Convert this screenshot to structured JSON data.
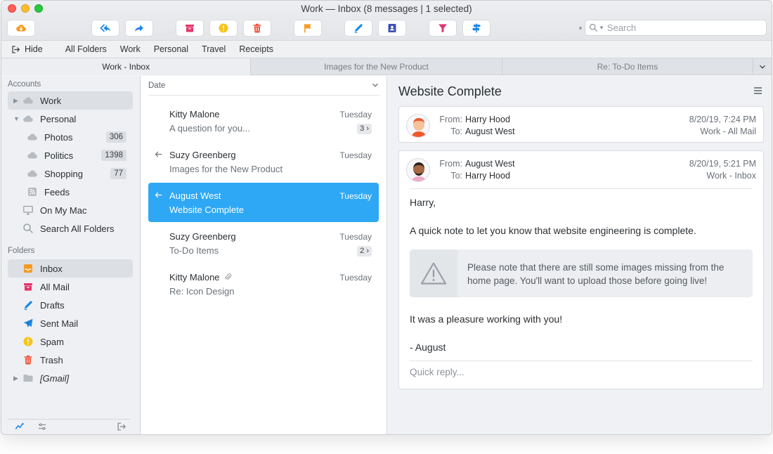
{
  "window": {
    "title": "Work — Inbox (8 messages | 1 selected)"
  },
  "toolbar": {
    "buttons": [
      {
        "id": "get-mail",
        "icon": "cloud-download-icon",
        "color": "#f59a23"
      },
      {
        "id": "reply-all",
        "icon": "reply-all-icon",
        "color": "#1e88e5"
      },
      {
        "id": "forward",
        "icon": "forward-icon",
        "color": "#1e88e5"
      },
      {
        "id": "archive",
        "icon": "archive-icon",
        "color": "#e6336b"
      },
      {
        "id": "spam",
        "icon": "spam-icon",
        "color": "#f5c518"
      },
      {
        "id": "trash",
        "icon": "trash-icon",
        "color": "#f0553c"
      },
      {
        "id": "flag",
        "icon": "flag-icon",
        "color": "#f59a23"
      },
      {
        "id": "compose",
        "icon": "compose-icon",
        "color": "#1e88e5"
      },
      {
        "id": "contacts",
        "icon": "contacts-icon",
        "color": "#3f51b5"
      },
      {
        "id": "filter",
        "icon": "filter-icon",
        "color": "#e6336b"
      },
      {
        "id": "rules",
        "icon": "signpost-icon",
        "color": "#1e88e5"
      }
    ],
    "search_placeholder": "Search"
  },
  "favorites": {
    "hide_label": "Hide",
    "items": [
      "All Folders",
      "Work",
      "Personal",
      "Travel",
      "Receipts"
    ]
  },
  "tabs": [
    {
      "label": "Work - Inbox",
      "active": true
    },
    {
      "label": "Images for the New Product",
      "active": false
    },
    {
      "label": "Re: To-Do Items",
      "active": false
    }
  ],
  "sidebar": {
    "accounts_label": "Accounts",
    "folders_label": "Folders",
    "accounts": [
      {
        "label": "Work",
        "count": ""
      },
      {
        "label": "Personal",
        "count": ""
      },
      {
        "label": "Photos",
        "count": "306"
      },
      {
        "label": "Politics",
        "count": "1398"
      },
      {
        "label": "Shopping",
        "count": "77"
      },
      {
        "label": "Feeds",
        "count": ""
      },
      {
        "label": "On My Mac",
        "count": ""
      },
      {
        "label": "Search All Folders",
        "count": ""
      }
    ],
    "folders": [
      {
        "label": "Inbox"
      },
      {
        "label": "All Mail"
      },
      {
        "label": "Drafts"
      },
      {
        "label": "Sent Mail"
      },
      {
        "label": "Spam"
      },
      {
        "label": "Trash"
      },
      {
        "label": "[Gmail]"
      }
    ]
  },
  "message_list": {
    "sort_label": "Date",
    "messages": [
      {
        "sender": "Kitty Malone",
        "subject": "A question for you...",
        "date": "Tuesday",
        "thread_count": "3",
        "replied": false,
        "attachment": false,
        "selected": false
      },
      {
        "sender": "Suzy Greenberg",
        "subject": "Images for the New Product",
        "date": "Tuesday",
        "thread_count": "",
        "replied": true,
        "attachment": false,
        "selected": false
      },
      {
        "sender": "August West",
        "subject": "Website Complete",
        "date": "Tuesday",
        "thread_count": "",
        "replied": true,
        "attachment": false,
        "selected": true
      },
      {
        "sender": "Suzy Greenberg",
        "subject": "To-Do Items",
        "date": "Tuesday",
        "thread_count": "2",
        "replied": false,
        "attachment": false,
        "selected": false
      },
      {
        "sender": "Kitty Malone",
        "subject": "Re: Icon Design",
        "date": "Tuesday",
        "thread_count": "",
        "replied": false,
        "attachment": true,
        "selected": false
      }
    ]
  },
  "reader": {
    "subject": "Website Complete",
    "from_label": "From:",
    "to_label": "To:",
    "thread": [
      {
        "from": "Harry Hood",
        "to": "August West",
        "date": "8/20/19, 7:24 PM",
        "mailbox": "Work - All Mail"
      },
      {
        "from": "August West",
        "to": "Harry Hood",
        "date": "8/20/19, 5:21 PM",
        "mailbox": "Work - Inbox"
      }
    ],
    "body": {
      "greeting": "Harry,",
      "line1": "A quick note to let you know that website engineering is complete.",
      "note": "Please note that there are still some images missing from the home page. You'll want to upload those before going live!",
      "line2": "It was a pleasure working with you!",
      "signoff": "- August"
    },
    "quick_reply_placeholder": "Quick reply..."
  },
  "colors": {
    "accent": "#2ea8f5",
    "cloud_gray": "#b7bcc2"
  }
}
